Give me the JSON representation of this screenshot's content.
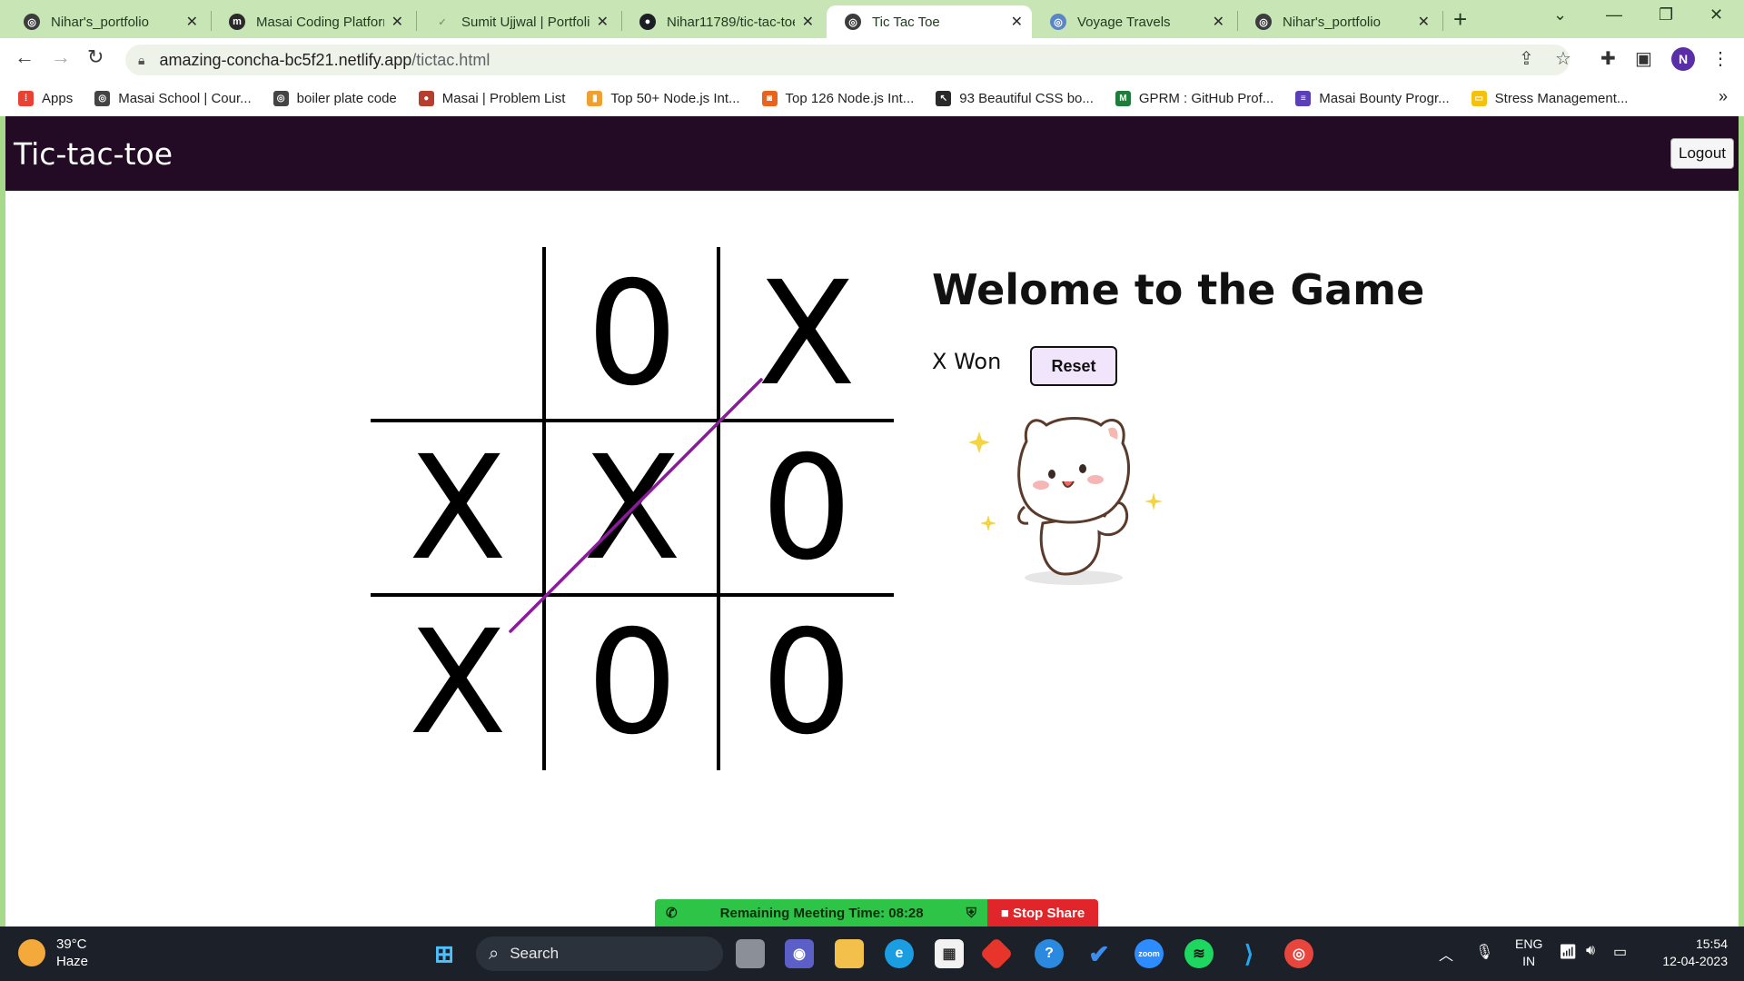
{
  "browser": {
    "tabs": [
      {
        "title": "Nihar's_portfolio",
        "icon": "globe-icon"
      },
      {
        "title": "Masai Coding Platform",
        "icon": "masai-m-icon"
      },
      {
        "title": "Sumit Ujjwal | Portfolio",
        "icon": "checkmark-icon"
      },
      {
        "title": "Nihar11789/tic-tac-toe",
        "icon": "github-icon"
      },
      {
        "title": "Tic Tac Toe",
        "icon": "globe-icon",
        "active": true
      },
      {
        "title": "Voyage Travels",
        "icon": "globe-icon"
      },
      {
        "title": "Nihar's_portfolio",
        "icon": "globe-icon"
      }
    ],
    "url_host": "amazing-concha-bc5f21.netlify.app",
    "url_path": "/tictac.html",
    "profile_initial": "N",
    "bookmarks": [
      {
        "label": "Apps",
        "color": "#e94235"
      },
      {
        "label": "Masai School | Cour...",
        "color": "#444444"
      },
      {
        "label": "boiler plate code",
        "color": "#444444"
      },
      {
        "label": "Masai | Problem List",
        "color": "#b53e2e"
      },
      {
        "label": "Top 50+ Node.js Int...",
        "color": "#f0a030"
      },
      {
        "label": "Top 126 Node.js Int...",
        "color": "#e8631b"
      },
      {
        "label": "93 Beautiful CSS bo...",
        "color": "#2a2a2a"
      },
      {
        "label": "GPRM : GitHub Prof...",
        "color": "#1e7d3a"
      },
      {
        "label": "Masai Bounty Progr...",
        "color": "#5b3fb8"
      },
      {
        "label": "Stress Management...",
        "color": "#f4c20d"
      }
    ]
  },
  "page": {
    "brand": "Tic-tac-toe",
    "logout_label": "Logout",
    "heading": "Welome to the Game",
    "status": "X Won",
    "reset_label": "Reset",
    "board": [
      "",
      "0",
      "X",
      "X",
      "X",
      "0",
      "X",
      "0",
      "0"
    ],
    "win_line_color": "#8a1c9c"
  },
  "meeting": {
    "remaining": "Remaining Meeting Time: 08:28",
    "stop_label": "Stop Share"
  },
  "taskbar": {
    "temperature": "39°C",
    "weather": "Haze",
    "search_placeholder": "Search",
    "lang_top": "ENG",
    "lang_bottom": "IN",
    "time": "15:54",
    "date": "12-04-2023"
  }
}
